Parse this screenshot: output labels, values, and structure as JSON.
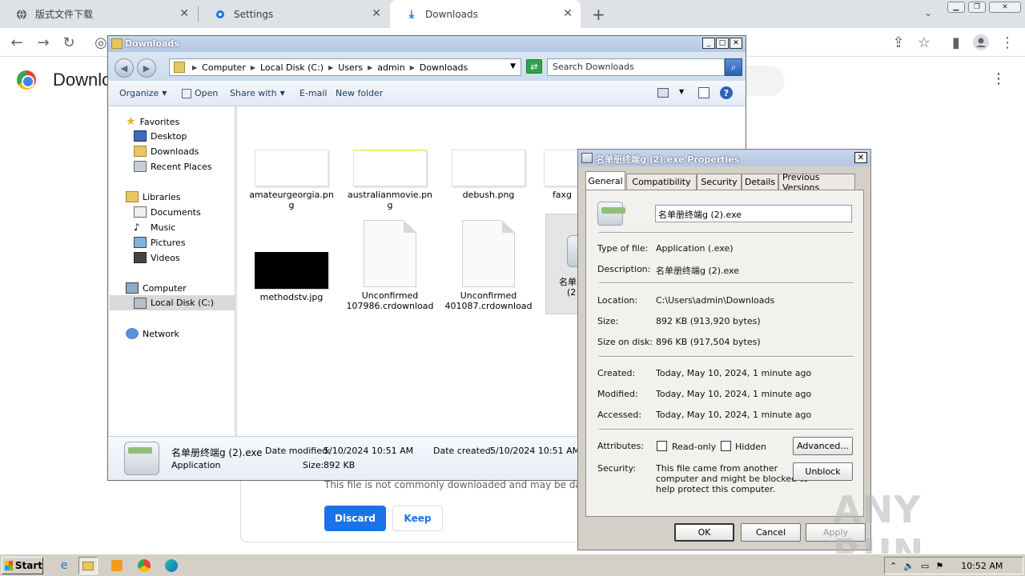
{
  "browser": {
    "tabs": [
      {
        "label": "版式文件下载",
        "icon": "globe-icon"
      },
      {
        "label": "Settings",
        "icon": "gear-icon"
      },
      {
        "label": "Downloads",
        "icon": "download-icon"
      }
    ],
    "new_tab": "+",
    "page_title": "Downlo",
    "download_warning": "This file is not commonly downloaded and may be dange",
    "discard_label": "Discard",
    "keep_label": "Keep",
    "accent": "#1a73e8"
  },
  "explorer": {
    "title": "Downloads",
    "breadcrumb": [
      "Computer",
      "Local Disk (C:)",
      "Users",
      "admin",
      "Downloads"
    ],
    "search_placeholder": "Search Downloads",
    "commands": [
      "Organize",
      "Open",
      "Share with",
      "E-mail",
      "New folder"
    ],
    "nav": {
      "favorites": "Favorites",
      "favorite_items": [
        "Desktop",
        "Downloads",
        "Recent Places"
      ],
      "libraries": "Libraries",
      "library_items": [
        "Documents",
        "Music",
        "Pictures",
        "Videos"
      ],
      "computer": "Computer",
      "computer_items": [
        "Local Disk (C:)"
      ],
      "network": "Network"
    },
    "files": [
      {
        "name": "amateurgeorgia.png",
        "name_line1": "amateurgeorgia.pn",
        "name_line2": "g"
      },
      {
        "name": "australianmovie.png",
        "name_line1": "australianmovie.pn",
        "name_line2": "g"
      },
      {
        "name": "debush.png",
        "name_line1": "debush.png",
        "name_line2": ""
      },
      {
        "name": "faxg",
        "name_line1": "faxg",
        "name_line2": ""
      },
      {
        "name": "methodstv.jpg",
        "name_line1": "methodstv.jpg",
        "name_line2": ""
      },
      {
        "name": "Unconfirmed 107986.crdownload",
        "name_line1": "Unconfirmed",
        "name_line2": "107986.crdownload"
      },
      {
        "name": "Unconfirmed 401087.crdownload",
        "name_line1": "Unconfirmed",
        "name_line2": "401087.crdownload"
      },
      {
        "name": "名单",
        "name_line1": "名单",
        "name_line2": "(2"
      }
    ],
    "details": {
      "filename": "名单册终端g (2).exe",
      "type": "Application",
      "date_modified_label": "Date modified:",
      "date_modified": "5/10/2024 10:51 AM",
      "date_created_label": "Date created:",
      "date_created": "5/10/2024 10:51 AM",
      "size_label": "Size:",
      "size": "892 KB"
    }
  },
  "properties": {
    "title": "名单册终端g (2).exe Properties",
    "tabs": [
      "General",
      "Compatibility",
      "Security",
      "Details",
      "Previous Versions"
    ],
    "name_value": "名单册终端g (2).exe",
    "rows": {
      "type_label": "Type of file:",
      "type_value": "Application (.exe)",
      "desc_label": "Description:",
      "desc_value": "名单册终端g (2).exe",
      "location_label": "Location:",
      "location_value": "C:\\Users\\admin\\Downloads",
      "size_label": "Size:",
      "size_value": "892 KB (913,920 bytes)",
      "sizedisk_label": "Size on disk:",
      "sizedisk_value": "896 KB (917,504 bytes)",
      "created_label": "Created:",
      "created_value": "Today, May 10, 2024, 1 minute ago",
      "modified_label": "Modified:",
      "modified_value": "Today, May 10, 2024, 1 minute ago",
      "accessed_label": "Accessed:",
      "accessed_value": "Today, May 10, 2024, 1 minute ago",
      "attributes_label": "Attributes:",
      "readonly_label": "Read-only",
      "hidden_label": "Hidden",
      "advanced_label": "Advanced...",
      "security_label": "Security:",
      "security_line1": "This file came from another",
      "security_line2": "computer and might be blocked to",
      "security_line3": "help protect this computer.",
      "unblock_label": "Unblock"
    },
    "ok_label": "OK",
    "cancel_label": "Cancel",
    "apply_label": "Apply"
  },
  "taskbar": {
    "start_label": "Start",
    "clock": "10:52 AM"
  },
  "watermark": "ANY RUN"
}
